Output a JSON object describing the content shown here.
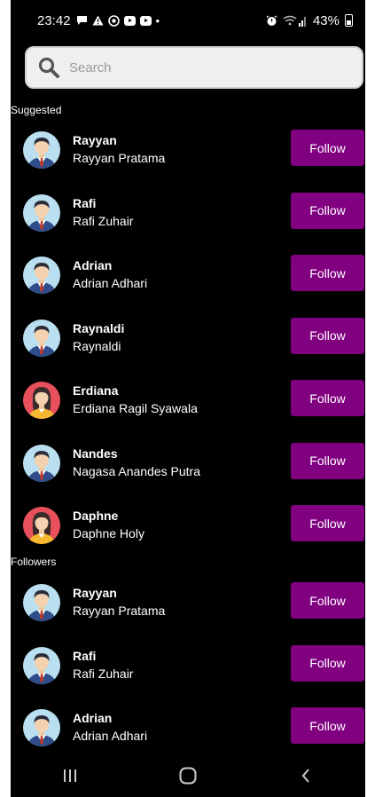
{
  "status_bar": {
    "time": "23:42",
    "battery": "43%"
  },
  "search": {
    "placeholder": "Search"
  },
  "sections": {
    "suggested_title": "Suggested",
    "followers_title": "Followers"
  },
  "suggested": [
    {
      "username": "Rayyan",
      "fullname": "Rayyan Pratama",
      "avatar": "male-avatar-icon",
      "button": "Follow"
    },
    {
      "username": "Rafi",
      "fullname": "Rafi Zuhair",
      "avatar": "male-avatar-icon",
      "button": "Follow"
    },
    {
      "username": "Adrian",
      "fullname": "Adrian Adhari",
      "avatar": "male-avatar-icon",
      "button": "Follow"
    },
    {
      "username": "Raynaldi",
      "fullname": "Raynaldi",
      "avatar": "male-avatar-icon",
      "button": "Follow"
    },
    {
      "username": "Erdiana",
      "fullname": "Erdiana Ragil Syawala",
      "avatar": "female-avatar-icon",
      "button": "Follow"
    },
    {
      "username": "Nandes",
      "fullname": "Nagasa Anandes Putra",
      "avatar": "male-avatar-icon",
      "button": "Follow"
    },
    {
      "username": "Daphne",
      "fullname": "Daphne Holy",
      "avatar": "female-avatar-icon",
      "button": "Follow"
    }
  ],
  "followers": [
    {
      "username": "Rayyan",
      "fullname": "Rayyan Pratama",
      "avatar": "male-avatar-icon",
      "button": "Follow"
    },
    {
      "username": "Rafi",
      "fullname": "Rafi Zuhair",
      "avatar": "male-avatar-icon",
      "button": "Follow"
    },
    {
      "username": "Adrian",
      "fullname": "Adrian Adhari",
      "avatar": "male-avatar-icon",
      "button": "Follow"
    }
  ],
  "colors": {
    "background": "#000000",
    "button": "#800080",
    "search_bg": "#efefef"
  }
}
